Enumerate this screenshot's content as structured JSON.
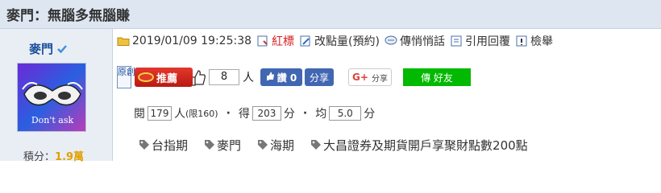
{
  "title": "麥門：無腦多無腦賺",
  "author": {
    "name": "麥門",
    "avatar_text": "Don't ask",
    "rank_label": "積分",
    "rank_value": "1.9萬"
  },
  "meta": {
    "datetime": "2019/01/09 19:25:38",
    "items": [
      {
        "label": "紅標",
        "icon": "flag-icon",
        "highlight": true
      },
      {
        "label": "改點量(預約)",
        "icon": "edit-icon",
        "highlight": false
      },
      {
        "label": "傳悄悄話",
        "icon": "message-icon",
        "highlight": false
      },
      {
        "label": "引用回覆",
        "icon": "quote-icon",
        "highlight": false
      },
      {
        "label": "檢舉",
        "icon": "report-icon",
        "highlight": false
      }
    ]
  },
  "actions": {
    "original_label": "原創",
    "recommend_label": "推薦",
    "recommend_count": "8",
    "person_unit": "人",
    "fb_like_label": "讚 0",
    "fb_share_label": "分享",
    "g_share_label": "分享",
    "line_label": "傳 好友"
  },
  "stats": {
    "read_label": "閱",
    "read_value": "179",
    "read_unit": "人",
    "read_limit": "(限160)",
    "score_label": "得",
    "score_value": "203",
    "score_unit": "分",
    "avg_label": "均",
    "avg_value": "5.0",
    "avg_unit": "分"
  },
  "tags": [
    "台指期",
    "麥門",
    "海期",
    "大昌證券及期貨開戶享聚財點數200點"
  ],
  "colors": {
    "header_bg": "#dde6f1",
    "sidebar_bg": "#e9eef5",
    "link_blue": "#1a4f9c",
    "accent_red": "#d62020",
    "line_green": "#00b900",
    "fb_blue": "#4267b2"
  }
}
